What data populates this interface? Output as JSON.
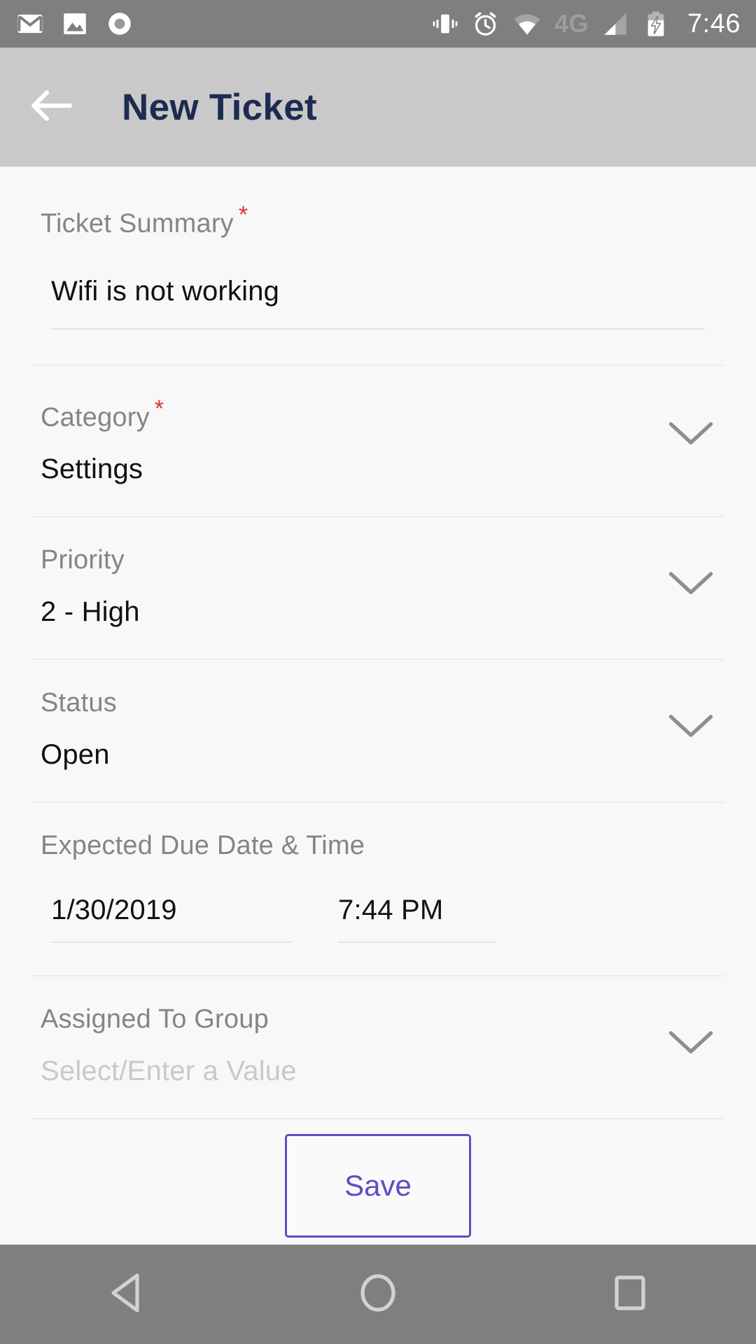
{
  "status_bar": {
    "time": "7:46",
    "network_label": "4G",
    "icons": [
      "gmail-icon",
      "photos-icon",
      "record-icon",
      "vibrate-icon",
      "alarm-icon",
      "wifi-icon",
      "signal-icon",
      "battery-charging-icon"
    ],
    "background_color": "#7f7f7f"
  },
  "app_bar": {
    "title": "New Ticket",
    "back_icon": "arrow-back-icon",
    "background_color": "#c9c9c9",
    "title_color": "#1d2b50"
  },
  "form": {
    "fields": [
      {
        "label": "Ticket Summary",
        "required": true,
        "value": "Wifi is not working",
        "type": "text",
        "has_chevron": false
      },
      {
        "label": "Category",
        "required": true,
        "value": "Settings",
        "type": "dropdown",
        "has_chevron": true
      },
      {
        "label": "Priority",
        "required": false,
        "value": "2 - High",
        "type": "dropdown",
        "has_chevron": true
      },
      {
        "label": "Status",
        "required": false,
        "value": "Open",
        "type": "dropdown",
        "has_chevron": true
      },
      {
        "label": "Expected Due Date & Time",
        "required": false,
        "type": "datetime",
        "date_value": "1/30/2019",
        "time_value": "7:44 PM",
        "has_chevron": false
      },
      {
        "label": "Assigned To Group",
        "required": false,
        "value": "Select/Enter a Value",
        "is_placeholder": true,
        "type": "dropdown",
        "has_chevron": true
      }
    ],
    "required_marker": "*",
    "label_color": "#858585",
    "value_color": "#111111",
    "placeholder_color": "#c9c9c9"
  },
  "actions": {
    "save_label": "Save",
    "save_color": "#5b4fc4"
  },
  "nav_bar": {
    "back_icon": "nav-back-triangle-icon",
    "home_icon": "nav-home-circle-icon",
    "recents_icon": "nav-recents-square-icon",
    "background_color": "#7f7f7f"
  }
}
